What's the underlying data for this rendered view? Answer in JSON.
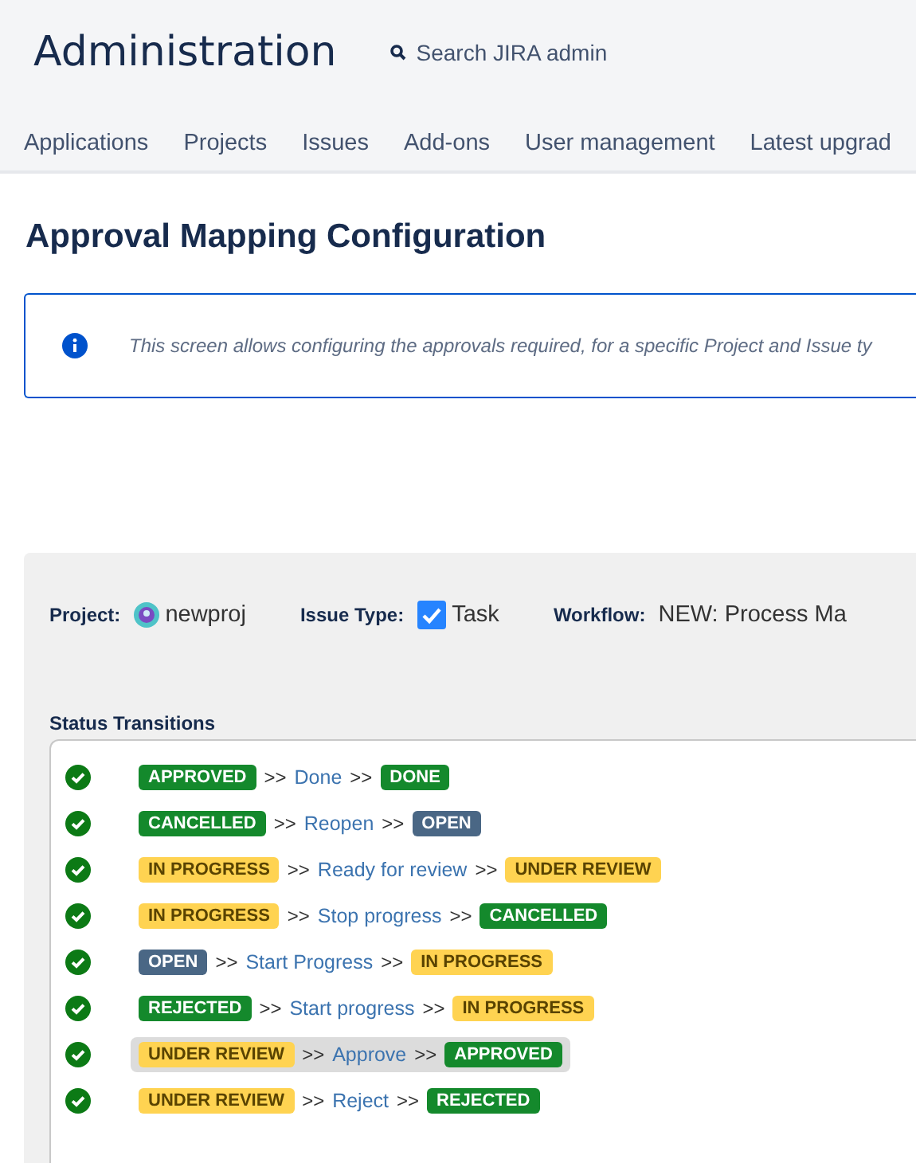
{
  "header": {
    "title": "Administration",
    "search": {
      "placeholder": "Search JIRA admin"
    }
  },
  "nav": [
    {
      "label": "Applications",
      "selected": false
    },
    {
      "label": "Projects",
      "selected": false
    },
    {
      "label": "Issues",
      "selected": false
    },
    {
      "label": "Add-ons",
      "selected": false
    },
    {
      "label": "User management",
      "selected": false
    },
    {
      "label": "Latest upgrad",
      "selected": false
    }
  ],
  "page": {
    "title": "Approval Mapping Configuration",
    "info": "This screen allows configuring the approvals required, for a specific Project and Issue ty"
  },
  "config": {
    "project_label": "Project:",
    "project": "newproj",
    "issue_type_label": "Issue Type:",
    "issue_type": "Task",
    "workflow_label": "Workflow:",
    "workflow": "NEW: Process Ma"
  },
  "transitions": {
    "title": "Status Transitions",
    "rows": [
      {
        "valid": true,
        "selected": false,
        "from": {
          "label": "APPROVED",
          "kind": "done"
        },
        "arrow_1": ">>",
        "name": "Done",
        "arrow_2": ">>",
        "to": {
          "label": "DONE",
          "kind": "done"
        }
      },
      {
        "valid": true,
        "selected": false,
        "from": {
          "label": "CANCELLED",
          "kind": "done"
        },
        "arrow_1": ">>",
        "name": "Reopen",
        "arrow_2": ">>",
        "to": {
          "label": "OPEN",
          "kind": "todo"
        }
      },
      {
        "valid": true,
        "selected": false,
        "from": {
          "label": "IN PROGRESS",
          "kind": "progress"
        },
        "arrow_1": ">>",
        "name": "Ready for review",
        "arrow_2": ">>",
        "to": {
          "label": "UNDER REVIEW",
          "kind": "progress"
        }
      },
      {
        "valid": true,
        "selected": false,
        "from": {
          "label": "IN PROGRESS",
          "kind": "progress"
        },
        "arrow_1": ">>",
        "name": "Stop progress",
        "arrow_2": ">>",
        "to": {
          "label": "CANCELLED",
          "kind": "done"
        }
      },
      {
        "valid": true,
        "selected": false,
        "from": {
          "label": "OPEN",
          "kind": "todo"
        },
        "arrow_1": ">>",
        "name": "Start Progress",
        "arrow_2": ">>",
        "to": {
          "label": "IN PROGRESS",
          "kind": "progress"
        }
      },
      {
        "valid": true,
        "selected": false,
        "from": {
          "label": "REJECTED",
          "kind": "done"
        },
        "arrow_1": ">>",
        "name": "Start progress",
        "arrow_2": ">>",
        "to": {
          "label": "IN PROGRESS",
          "kind": "progress"
        }
      },
      {
        "valid": true,
        "selected": true,
        "from": {
          "label": "UNDER REVIEW",
          "kind": "progress"
        },
        "arrow_1": ">>",
        "name": "Approve",
        "arrow_2": ">>",
        "to": {
          "label": "APPROVED",
          "kind": "done"
        }
      },
      {
        "valid": true,
        "selected": false,
        "from": {
          "label": "UNDER REVIEW",
          "kind": "progress"
        },
        "arrow_1": ">>",
        "name": "Reject",
        "arrow_2": ">>",
        "to": {
          "label": "REJECTED",
          "kind": "done"
        }
      }
    ]
  }
}
